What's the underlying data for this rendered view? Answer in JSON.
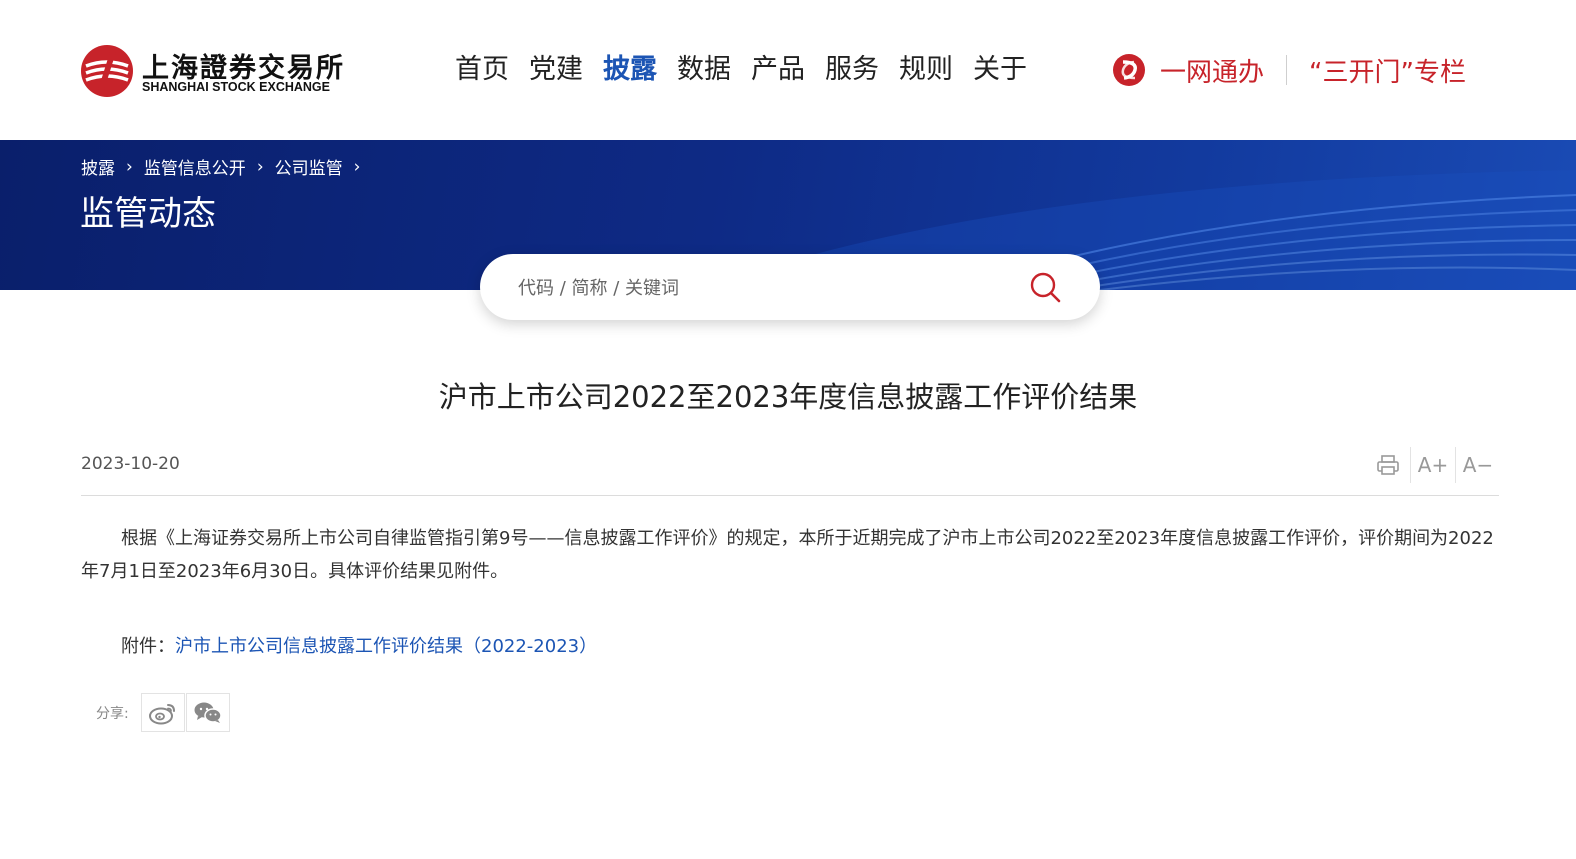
{
  "colors": {
    "brand_red": "#c7232a",
    "link_blue": "#1c55b4",
    "banner_navy": "#0e2a85"
  },
  "header": {
    "logo_cn": "上海證券交易所",
    "logo_en": "SHANGHAI STOCK EXCHANGE",
    "nav": [
      "首页",
      "党建",
      "披露",
      "数据",
      "产品",
      "服务",
      "规则",
      "关于"
    ],
    "active_nav": "披露",
    "ywtb_label": "一网通办",
    "skm_label": "“三开门”专栏"
  },
  "banner": {
    "breadcrumb": [
      "披露",
      "监管信息公开",
      "公司监管"
    ],
    "heading": "监管动态"
  },
  "search": {
    "placeholder": "代码 / 简称 / 关键词",
    "icon": "search-icon"
  },
  "article": {
    "title": "沪市上市公司2022至2023年度信息披露工作评价结果",
    "date": "2023-10-20",
    "tools": {
      "print_icon": "print-icon",
      "font_larger": "A+",
      "font_smaller": "A−"
    },
    "body": "根据《上海证券交易所上市公司自律监管指引第9号——信息披露工作评价》的规定，本所于近期完成了沪市上市公司2022至2023年度信息披露工作评价，评价期间为2022年7月1日至2023年6月30日。具体评价结果见附件。",
    "attachment_label": "附件：",
    "attachment_link": "沪市上市公司信息披露工作评价结果（2022-2023）"
  },
  "share": {
    "label": "分享:",
    "icons": [
      "weibo-icon",
      "wechat-icon"
    ]
  }
}
